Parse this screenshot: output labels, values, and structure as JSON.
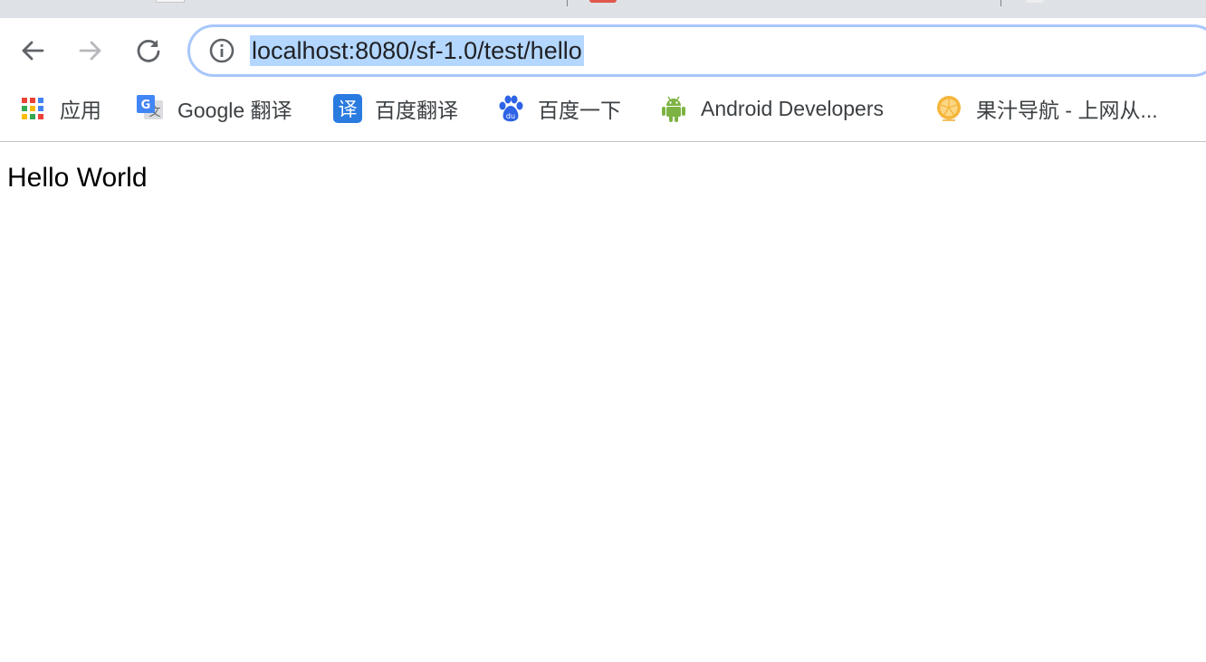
{
  "toolbar": {
    "back_icon": "arrow-left-icon",
    "forward_icon": "arrow-right-icon",
    "reload_icon": "reload-icon",
    "site_info_icon": "info-icon"
  },
  "omnibox": {
    "url": "localhost:8080/sf-1.0/test/hello",
    "selection_color": "#b4d7ff",
    "focus_ring_color": "#a8c7fa"
  },
  "bookmarks": [
    {
      "label": "应用",
      "icon": "apps-grid-icon"
    },
    {
      "label": "Google 翻译",
      "icon": "google-translate-icon"
    },
    {
      "label": "百度翻译",
      "icon": "baidu-translate-icon"
    },
    {
      "label": "百度一下",
      "icon": "baidu-paw-icon"
    },
    {
      "label": "Android Developers",
      "icon": "android-icon"
    },
    {
      "label": "果汁导航 - 上网从...",
      "icon": "orange-icon"
    }
  ],
  "page": {
    "text": "Hello World"
  }
}
